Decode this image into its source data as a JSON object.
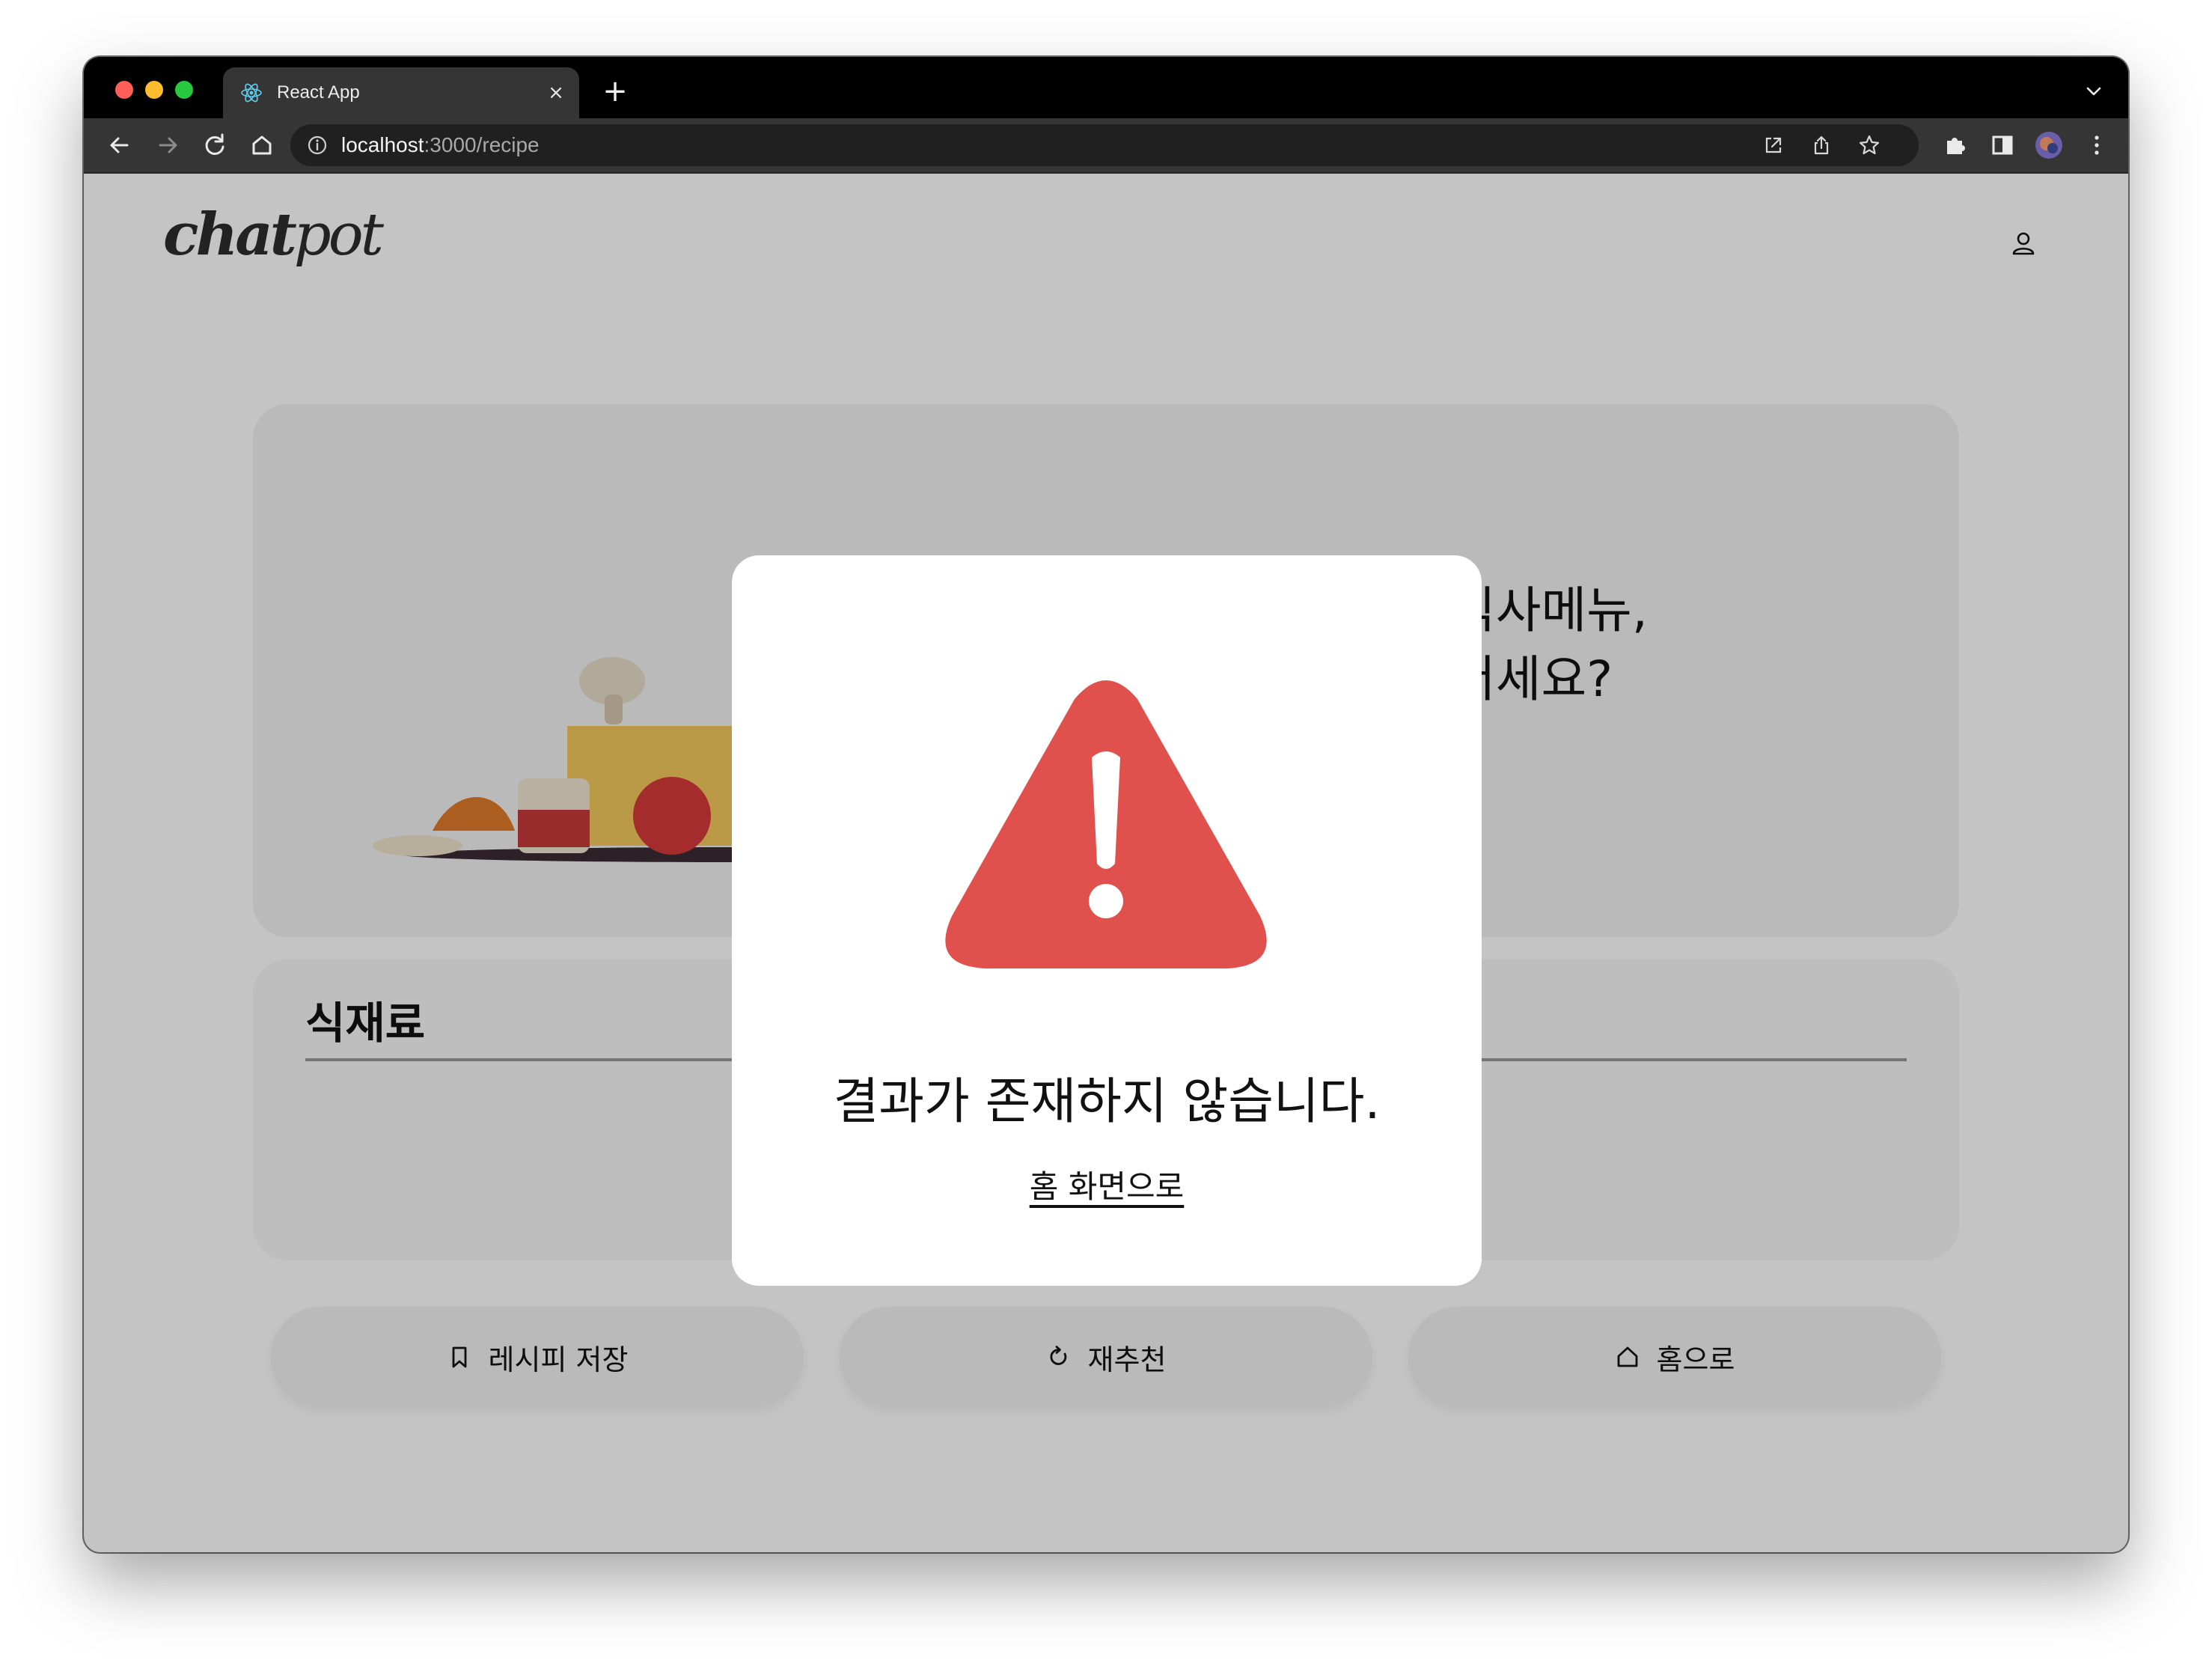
{
  "browser": {
    "tab_title": "React App",
    "tab_close": "×",
    "new_tab": "+",
    "url_host": "localhost",
    "url_path": ":3000/recipe"
  },
  "app": {
    "logo_bold": "chat",
    "logo_light": "pot"
  },
  "hero": {
    "text": "식사메뉴,\n더세요?"
  },
  "ingredients": {
    "title": "식재료"
  },
  "actions": [
    {
      "label": "레시피 저장",
      "icon": "bookmark-icon"
    },
    {
      "label": "재추천",
      "icon": "refresh-icon"
    },
    {
      "label": "홈으로",
      "icon": "home-icon"
    }
  ],
  "modal": {
    "icon": "warning-icon",
    "accent_color": "#e0514e",
    "message": "결과가 존재하지 않습니다.",
    "link": "홈 화면으로"
  }
}
